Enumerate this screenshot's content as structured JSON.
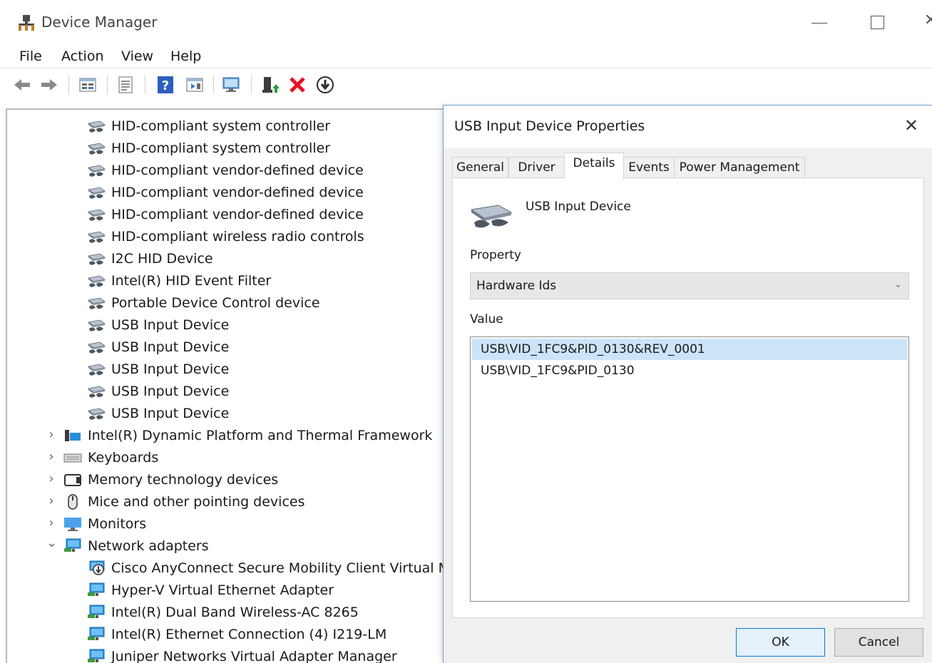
{
  "window": {
    "title": "Device Manager"
  },
  "menu": [
    "File",
    "Action",
    "View",
    "Help"
  ],
  "toolbar": {
    "icons": [
      "back-icon",
      "forward-icon",
      "properties-grid-icon",
      "list-icon",
      "help-icon",
      "view-icon",
      "monitor-icon",
      "update-driver-icon",
      "uninstall-icon",
      "download-icon"
    ]
  },
  "tree": {
    "items": [
      {
        "label": "HID-compliant system controller",
        "icon": "hid-icon",
        "level": 2
      },
      {
        "label": "HID-compliant system controller",
        "icon": "hid-icon",
        "level": 2
      },
      {
        "label": "HID-compliant vendor-defined device",
        "icon": "hid-icon",
        "level": 2
      },
      {
        "label": "HID-compliant vendor-defined device",
        "icon": "hid-icon",
        "level": 2
      },
      {
        "label": "HID-compliant vendor-defined device",
        "icon": "hid-icon",
        "level": 2
      },
      {
        "label": "HID-compliant wireless radio controls",
        "icon": "hid-icon",
        "level": 2
      },
      {
        "label": "I2C HID Device",
        "icon": "hid-icon",
        "level": 2
      },
      {
        "label": "Intel(R) HID Event Filter",
        "icon": "hid-icon",
        "level": 2
      },
      {
        "label": "Portable Device Control device",
        "icon": "hid-icon",
        "level": 2
      },
      {
        "label": "USB Input Device",
        "icon": "hid-icon",
        "level": 2
      },
      {
        "label": "USB Input Device",
        "icon": "hid-icon",
        "level": 2
      },
      {
        "label": "USB Input Device",
        "icon": "hid-icon",
        "level": 2
      },
      {
        "label": "USB Input Device",
        "icon": "hid-icon",
        "level": 2
      },
      {
        "label": "USB Input Device",
        "icon": "hid-icon",
        "level": 2
      },
      {
        "label": "Intel(R) Dynamic Platform and Thermal Framework",
        "icon": "folder-icon",
        "level": 1,
        "expander": "collapsed"
      },
      {
        "label": "Keyboards",
        "icon": "keyboard-icon",
        "level": 1,
        "expander": "collapsed"
      },
      {
        "label": "Memory technology devices",
        "icon": "memory-icon",
        "level": 1,
        "expander": "collapsed"
      },
      {
        "label": "Mice and other pointing devices",
        "icon": "mouse-icon",
        "level": 1,
        "expander": "collapsed"
      },
      {
        "label": "Monitors",
        "icon": "monitor-icon",
        "level": 1,
        "expander": "collapsed"
      },
      {
        "label": "Network adapters",
        "icon": "network-icon",
        "level": 1,
        "expander": "expanded"
      },
      {
        "label": "Cisco AnyConnect Secure Mobility Client Virtual Mir",
        "icon": "network-download-icon",
        "level": 2
      },
      {
        "label": "Hyper-V Virtual Ethernet Adapter",
        "icon": "network-icon",
        "level": 2
      },
      {
        "label": "Intel(R) Dual Band Wireless-AC 8265",
        "icon": "network-icon",
        "level": 2
      },
      {
        "label": "Intel(R) Ethernet Connection (4) I219-LM",
        "icon": "network-icon",
        "level": 2
      },
      {
        "label": "Juniper Networks Virtual Adapter Manager",
        "icon": "network-icon",
        "level": 2
      }
    ]
  },
  "dialog": {
    "title": "USB Input Device Properties",
    "tabs": [
      "General",
      "Driver",
      "Details",
      "Events",
      "Power Management"
    ],
    "active_tab": "Details",
    "device_name": "USB Input Device",
    "property_label": "Property",
    "property_value": "Hardware Ids",
    "value_label": "Value",
    "values": [
      "USB\\VID_1FC9&PID_0130&REV_0001",
      "USB\\VID_1FC9&PID_0130"
    ],
    "ok_label": "OK",
    "cancel_label": "Cancel"
  },
  "colors": {
    "selection": "#cce4f7",
    "dialog_border": "#6a9fd4",
    "default_button_border": "#0078d7",
    "uninstall_red": "#e81123"
  }
}
